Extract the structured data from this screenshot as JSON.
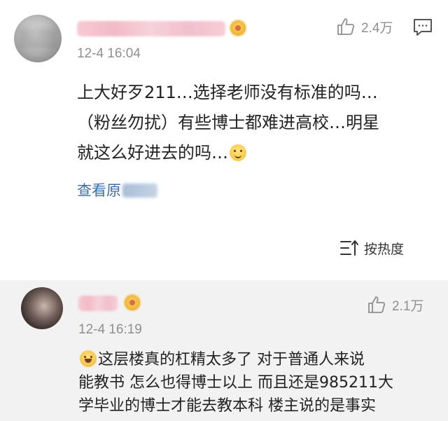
{
  "comments": [
    {
      "username": "",
      "timestamp": "12-4 16:04",
      "likes": "2.4万",
      "content_lines": [
        "上大好歹211…选择老师没有标准的吗…",
        "（粉丝勿扰）有些博士都难进高校…明星",
        "就这么好进去的吗…"
      ],
      "view_original_label": "查看原"
    }
  ],
  "sort": {
    "label": "按热度"
  },
  "reply": {
    "username": "",
    "timestamp": "12-4 16:19",
    "likes": "2.1万",
    "content_lines": [
      "这层楼真的杠精太多了  对于普通人来说",
      "能教书  怎么也得博士以上  而且还是985211大",
      "学毕业的博士才能去教本科  楼主说的是事实"
    ]
  },
  "icons": {
    "like": "thumbs-up-icon",
    "reply": "comment-reply-icon",
    "sort": "sort-icon",
    "vip": "vip-badge-icon",
    "emoji_upside_down": "upside-down-face-emoji",
    "emoji_laugh_cry": "laughing-crying-emoji"
  },
  "colors": {
    "link": "#3c6ea8",
    "meta": "#8f8f8f",
    "reply_bg": "#f2f2f2"
  }
}
